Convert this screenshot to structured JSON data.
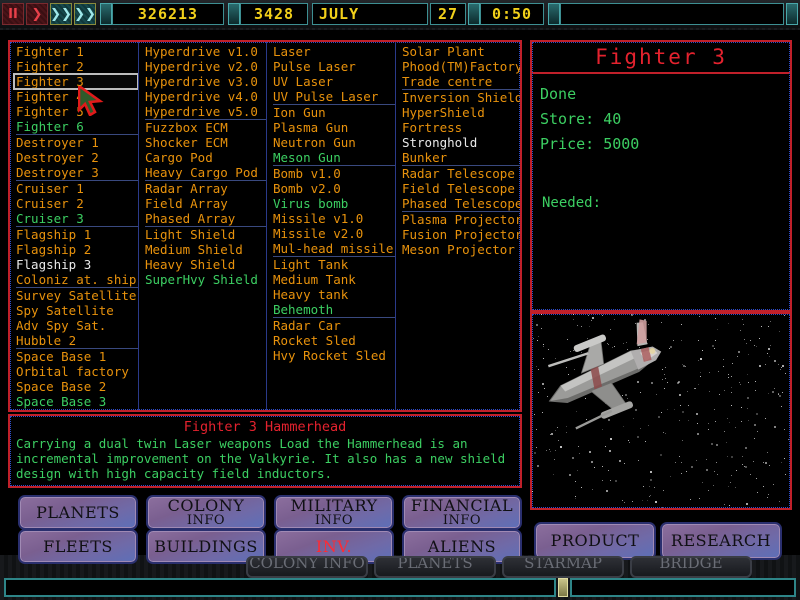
{
  "topbar": {
    "controls": [
      {
        "name": "pause-button",
        "glyph": "II",
        "style": "red"
      },
      {
        "name": "play-button",
        "glyph": "❯",
        "style": "red"
      },
      {
        "name": "fast-forward-button",
        "glyph": "❯❯",
        "style": "teal"
      },
      {
        "name": "ultra-forward-button",
        "glyph": "❯❯",
        "style": "teal"
      }
    ],
    "credits": "326213",
    "year": "3428",
    "month": "JULY",
    "day": "27",
    "clock": "0:50",
    "message": ""
  },
  "inventory": {
    "columns": [
      {
        "name": "ships-column",
        "items": [
          {
            "label": "Fighter 1",
            "state": "available"
          },
          {
            "label": "Fighter 2",
            "state": "available"
          },
          {
            "label": "Fighter 3",
            "state": "selected"
          },
          {
            "label": "Fighter 4",
            "state": "available"
          },
          {
            "label": "Fighter 5",
            "state": "available"
          },
          {
            "label": "Fighter 6",
            "state": "researching"
          },
          {
            "label": "Destroyer 1",
            "state": "available",
            "group": true
          },
          {
            "label": "Destroyer 2",
            "state": "available"
          },
          {
            "label": "Destroyer 3",
            "state": "available"
          },
          {
            "label": "Cruiser 1",
            "state": "available",
            "group": true
          },
          {
            "label": "Cruiser 2",
            "state": "available"
          },
          {
            "label": "Cruiser 3",
            "state": "researching"
          },
          {
            "label": "Flagship 1",
            "state": "available",
            "group": true
          },
          {
            "label": "Flagship 2",
            "state": "available"
          },
          {
            "label": "Flagship 3",
            "state": "highlighted"
          },
          {
            "label": "Coloniz at. ship",
            "state": "available"
          },
          {
            "label": "Survey Satellite",
            "state": "available",
            "group": true
          },
          {
            "label": "Spy Satellite",
            "state": "available"
          },
          {
            "label": "Adv Spy Sat.",
            "state": "available"
          },
          {
            "label": "Hubble 2",
            "state": "available"
          },
          {
            "label": "Space Base 1",
            "state": "available",
            "group": true
          },
          {
            "label": "Orbital factory",
            "state": "available"
          },
          {
            "label": "Space Base 2",
            "state": "available"
          },
          {
            "label": "Space Base 3",
            "state": "researching"
          }
        ]
      },
      {
        "name": "drives-column",
        "items": [
          {
            "label": "Hyperdrive v1.0",
            "state": "available"
          },
          {
            "label": "Hyperdrive v2.0",
            "state": "available"
          },
          {
            "label": "Hyperdrive v3.0",
            "state": "available"
          },
          {
            "label": "Hyperdrive v4.0",
            "state": "available"
          },
          {
            "label": "Hyperdrive v5.0",
            "state": "available"
          },
          {
            "label": "Fuzzbox ECM",
            "state": "available",
            "group": true
          },
          {
            "label": "Shocker ECM",
            "state": "available"
          },
          {
            "label": "Cargo Pod",
            "state": "available"
          },
          {
            "label": "Heavy Cargo Pod",
            "state": "available"
          },
          {
            "label": "Radar Array",
            "state": "available",
            "group": true
          },
          {
            "label": "Field Array",
            "state": "available"
          },
          {
            "label": "Phased Array",
            "state": "available"
          },
          {
            "label": "Light Shield",
            "state": "available",
            "group": true
          },
          {
            "label": "Medium Shield",
            "state": "available"
          },
          {
            "label": "Heavy Shield",
            "state": "available"
          },
          {
            "label": "SuperHvy Shield",
            "state": "researching"
          }
        ]
      },
      {
        "name": "weapons-column",
        "items": [
          {
            "label": "Laser",
            "state": "available"
          },
          {
            "label": "Pulse Laser",
            "state": "available"
          },
          {
            "label": "UV Laser",
            "state": "available"
          },
          {
            "label": "UV Pulse Laser",
            "state": "available"
          },
          {
            "label": "Ion Gun",
            "state": "available",
            "group": true
          },
          {
            "label": "Plasma Gun",
            "state": "available"
          },
          {
            "label": "Neutron Gun",
            "state": "available"
          },
          {
            "label": "Meson Gun",
            "state": "researching"
          },
          {
            "label": "Bomb v1.0",
            "state": "available",
            "group": true
          },
          {
            "label": "Bomb v2.0",
            "state": "available"
          },
          {
            "label": "Virus bomb",
            "state": "researching"
          },
          {
            "label": "Missile v1.0",
            "state": "available"
          },
          {
            "label": "Missile v2.0",
            "state": "available"
          },
          {
            "label": "Mul-head missile",
            "state": "available"
          },
          {
            "label": "Light Tank",
            "state": "available",
            "group": true
          },
          {
            "label": "Medium Tank",
            "state": "available"
          },
          {
            "label": "Heavy tank",
            "state": "available"
          },
          {
            "label": "Behemoth",
            "state": "researching"
          },
          {
            "label": "Radar Car",
            "state": "available",
            "group": true
          },
          {
            "label": "Rocket Sled",
            "state": "available"
          },
          {
            "label": "Hvy Rocket Sled",
            "state": "available"
          }
        ]
      },
      {
        "name": "buildings-column",
        "items": [
          {
            "label": "Solar Plant",
            "state": "available"
          },
          {
            "label": "Phood(TM)Factory",
            "state": "available"
          },
          {
            "label": "Trade centre",
            "state": "available"
          },
          {
            "label": "Inversion Shield",
            "state": "available",
            "group": true
          },
          {
            "label": "HyperShield",
            "state": "available"
          },
          {
            "label": "Fortress",
            "state": "available"
          },
          {
            "label": "Stronghold",
            "state": "highlighted"
          },
          {
            "label": "Bunker",
            "state": "available"
          },
          {
            "label": "Radar Telescope",
            "state": "available",
            "group": true
          },
          {
            "label": "Field Telescope",
            "state": "available"
          },
          {
            "label": "Phased Telescope",
            "state": "available"
          },
          {
            "label": "Plasma Projector",
            "state": "available",
            "group": true
          },
          {
            "label": "Fusion Projector",
            "state": "available"
          },
          {
            "label": "Meson Projector",
            "state": "available"
          }
        ]
      }
    ]
  },
  "description": {
    "title": "Fighter 3 Hammerhead",
    "body": "Carrying a dual twin Laser weapons Load the Hammerhead is an incremental improvement on the Valkyrie. It also has a new shield design with high capacity field inductors."
  },
  "detail": {
    "title": "Fighter 3",
    "status": "Done",
    "store_label": "Store:",
    "store_value": "40",
    "price_label": "Price:",
    "price_value": "5000",
    "needed_label": "Needed:",
    "needed_items": ""
  },
  "nav": {
    "row1": [
      {
        "name": "planets-button",
        "l1": "PLANETS",
        "l2": "",
        "active": false
      },
      {
        "name": "colony-info-button",
        "l1": "COLONY",
        "l2": "INFO",
        "active": false
      },
      {
        "name": "military-info-button",
        "l1": "MILITARY",
        "l2": "INFO",
        "active": false
      },
      {
        "name": "financial-info-button",
        "l1": "FINANCIAL",
        "l2": "INFO",
        "active": false
      }
    ],
    "row2": [
      {
        "name": "fleets-button",
        "l1": "FLEETS",
        "l2": "",
        "active": false
      },
      {
        "name": "buildings-button",
        "l1": "BUILDINGS",
        "l2": "",
        "active": false
      },
      {
        "name": "inventory-button",
        "l1": "INV.",
        "l2": "",
        "active": true
      },
      {
        "name": "aliens-button",
        "l1": "ALIENS",
        "l2": "",
        "active": false
      }
    ],
    "side": [
      {
        "name": "product-button",
        "l1": "PRODUCT",
        "l2": "",
        "active": false
      },
      {
        "name": "research-button",
        "l1": "RESEARCH",
        "l2": "",
        "active": false
      }
    ],
    "occluded": [
      {
        "name": "colony-info-bottom-button",
        "label": "COLONY INFO"
      },
      {
        "name": "planets-bottom-button",
        "label": "PLANETS"
      },
      {
        "name": "starmap-bottom-button",
        "label": "STARMAP"
      },
      {
        "name": "bridge-bottom-button",
        "label": "BRIDGE"
      }
    ]
  },
  "status_bar": {
    "left_text": "",
    "right_text": ""
  },
  "colors": {
    "item_available": "#e8920c",
    "item_researching": "#3ccf62",
    "item_highlighted": "#e9e9e9",
    "panel_border": "#c0202a",
    "panel_outline": "#2b4cc8",
    "lcd_text": "#f2d01a",
    "accent_red": "#e4222e"
  }
}
